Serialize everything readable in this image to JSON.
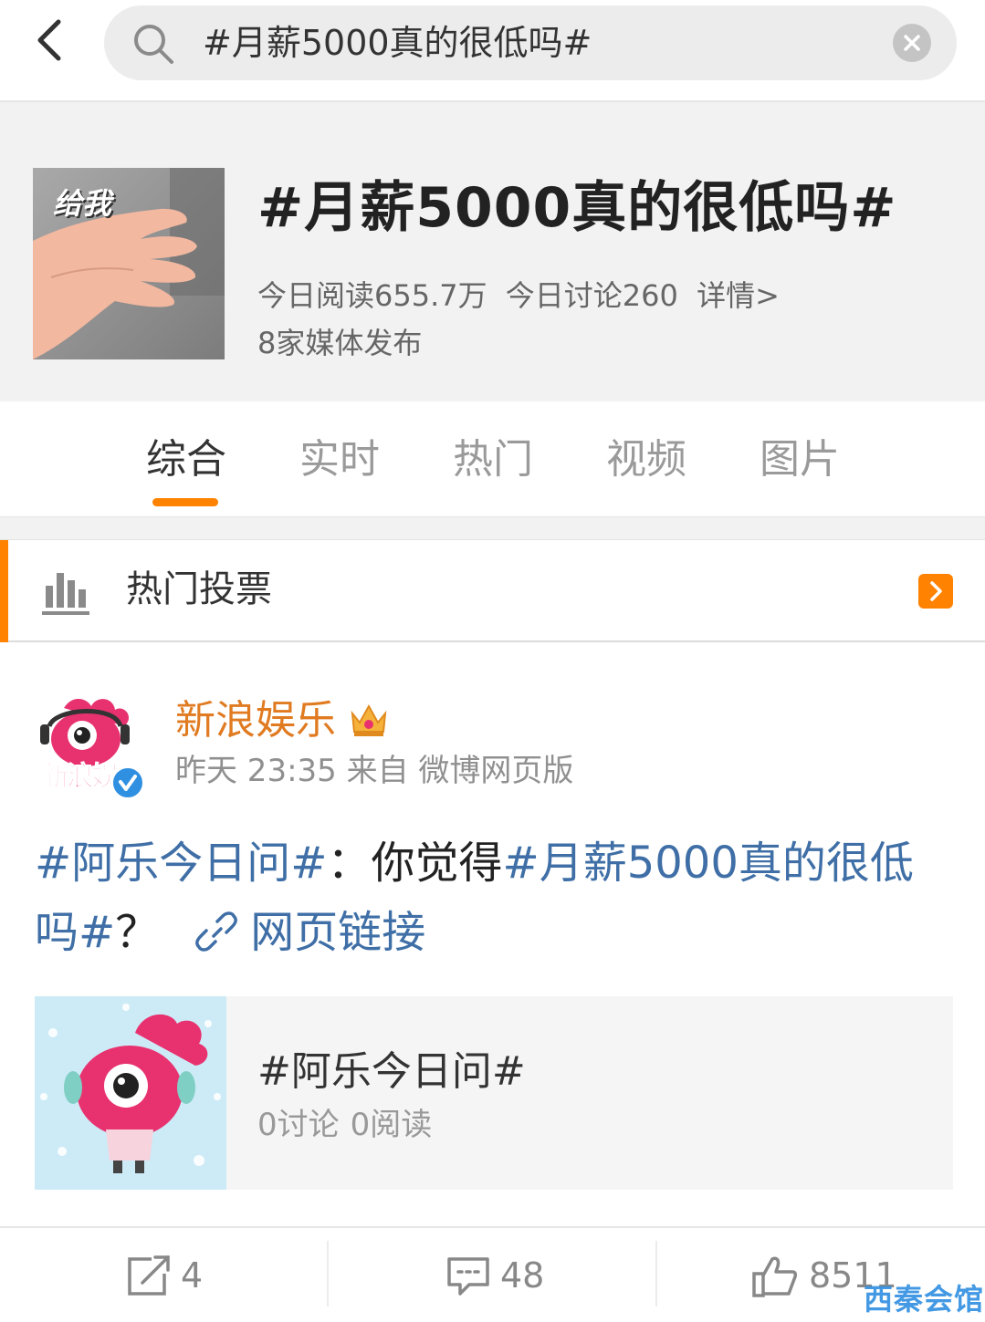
{
  "search": {
    "query": "#月薪5000真的很低吗#"
  },
  "topic": {
    "title": "#月薪5000真的很低吗#",
    "cover_caption": "给我",
    "reads_today": "今日阅读655.7万",
    "discussions_today": "今日讨论260",
    "details_link": "详情>",
    "media_count": "8家媒体发布"
  },
  "tabs": [
    {
      "label": "综合",
      "active": true
    },
    {
      "label": "实时",
      "active": false
    },
    {
      "label": "热门",
      "active": false
    },
    {
      "label": "视频",
      "active": false
    },
    {
      "label": "图片",
      "active": false
    }
  ],
  "hot_vote": {
    "label": "热门投票"
  },
  "post": {
    "author": "新浪娱乐",
    "avatar_caption": "新浪娱",
    "meta": "昨天 23:35 来自 微博网页版",
    "tag1": "#阿乐今日问#",
    "colon": "：",
    "text_middle": "你觉得",
    "tag2": "#月薪5000真的很低吗#",
    "question_mark": "？",
    "link_text": "网页链接",
    "card": {
      "title": "#阿乐今日问#",
      "discussions": "0讨论",
      "reads": "0阅读"
    }
  },
  "actions": {
    "repost_count": "4",
    "comment_count": "48",
    "like_count": "8511"
  },
  "watermark": "西秦会馆",
  "colors": {
    "accent": "#ff8200",
    "link": "#3f6fa6",
    "author": "#e07b21",
    "verified": "#2f8fe0"
  }
}
